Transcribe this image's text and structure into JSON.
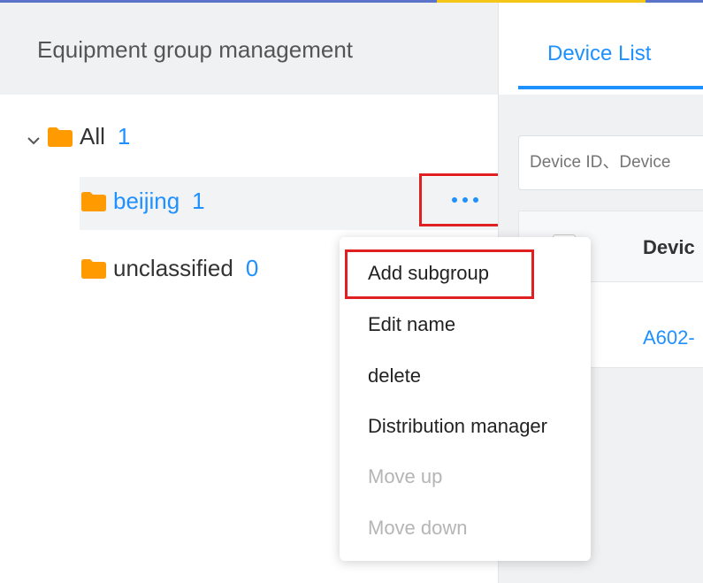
{
  "colors": {
    "accent": "#1e90ff",
    "highlight": "#e02020",
    "folder": "#ff9a00",
    "disabled": "#b5b5b5"
  },
  "left_panel": {
    "title": "Equipment group management",
    "tree": [
      {
        "label": "All",
        "count": "1",
        "icon": "folder-icon",
        "expanded": true
      },
      {
        "label": "beijing",
        "count": "1",
        "icon": "folder-icon",
        "selected": true
      },
      {
        "label": "unclassified",
        "count": "0",
        "icon": "folder-icon"
      }
    ],
    "more_icon": "ellipsis-icon"
  },
  "context_menu": {
    "items": [
      {
        "label": "Add subgroup",
        "enabled": true
      },
      {
        "label": "Edit name",
        "enabled": true
      },
      {
        "label": "delete",
        "enabled": true
      },
      {
        "label": "Distribution manager",
        "enabled": true
      },
      {
        "label": "Move up",
        "enabled": false
      },
      {
        "label": "Move down",
        "enabled": false
      }
    ]
  },
  "right_panel": {
    "tab": "Device List",
    "search_placeholder": "Device ID、Device",
    "table": {
      "header": "Devic",
      "rows": [
        {
          "device": "A602-"
        }
      ]
    }
  }
}
